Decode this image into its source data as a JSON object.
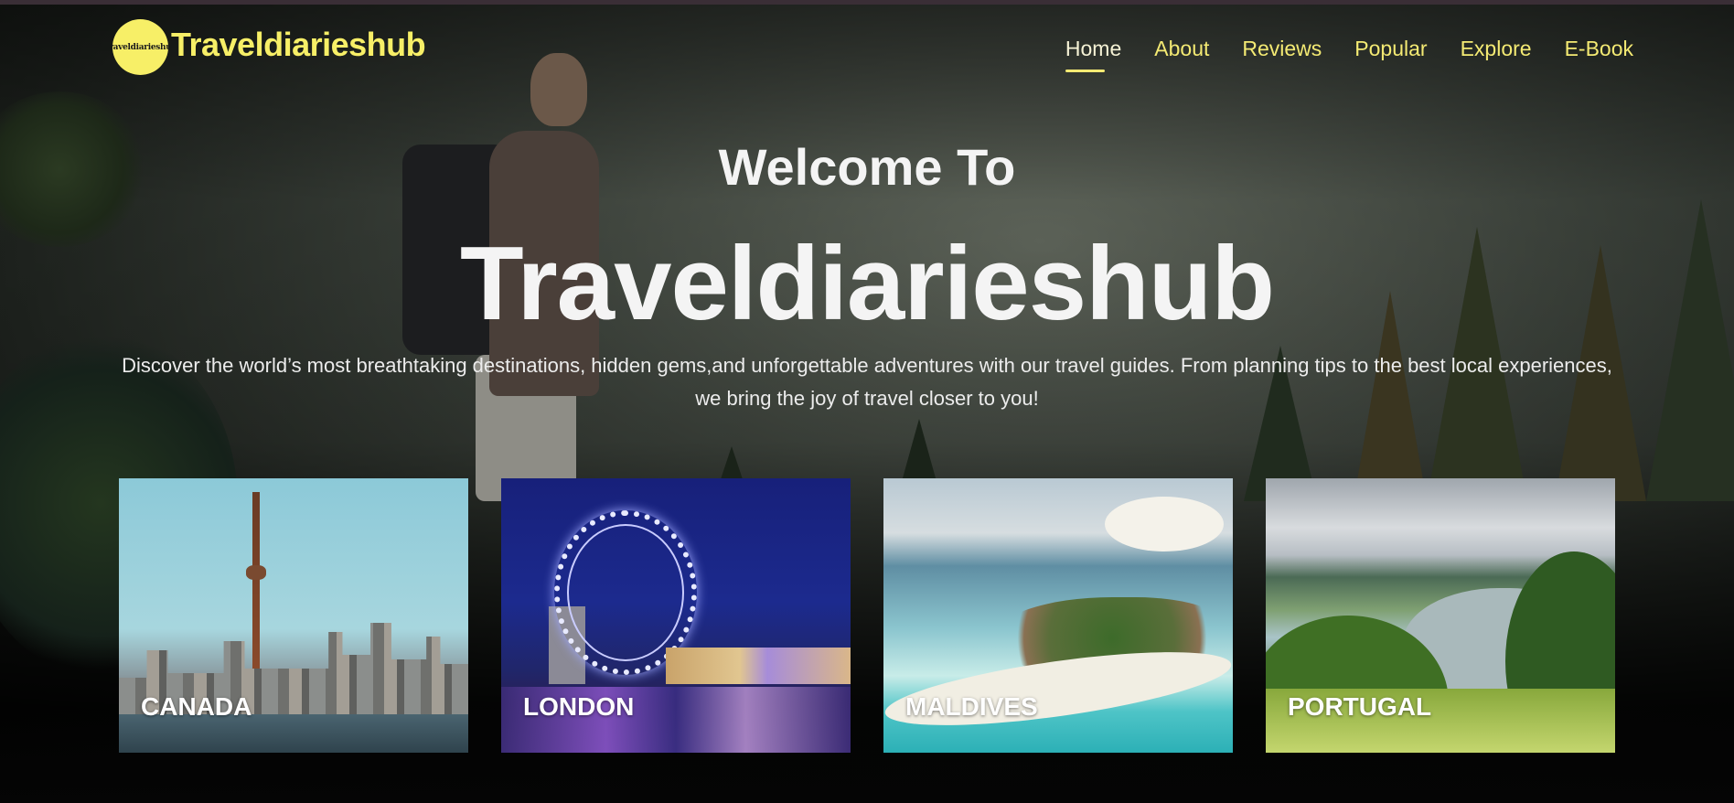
{
  "brand": {
    "logo_text": "Traveldiarieshub",
    "name": "Traveldiarieshub"
  },
  "nav": {
    "items": [
      {
        "label": "Home",
        "active": true
      },
      {
        "label": "About",
        "active": false
      },
      {
        "label": "Reviews",
        "active": false
      },
      {
        "label": "Popular",
        "active": false
      },
      {
        "label": "Explore",
        "active": false
      },
      {
        "label": "E-Book",
        "active": false
      }
    ]
  },
  "hero": {
    "welcome": "Welcome To",
    "title": "Traveldiarieshub",
    "description": "Discover the world’s most breathtaking destinations, hidden gems,and unforgettable adventures with our travel guides. From planning tips to the best local experiences, we bring the joy of travel closer to you!"
  },
  "destinations": [
    {
      "label": "CANADA"
    },
    {
      "label": "LONDON"
    },
    {
      "label": "MALDIVES"
    },
    {
      "label": "PORTUGAL"
    }
  ],
  "colors": {
    "accent": "#f4ea73",
    "logo_badge": "#f7ef67",
    "background": "#050505"
  }
}
